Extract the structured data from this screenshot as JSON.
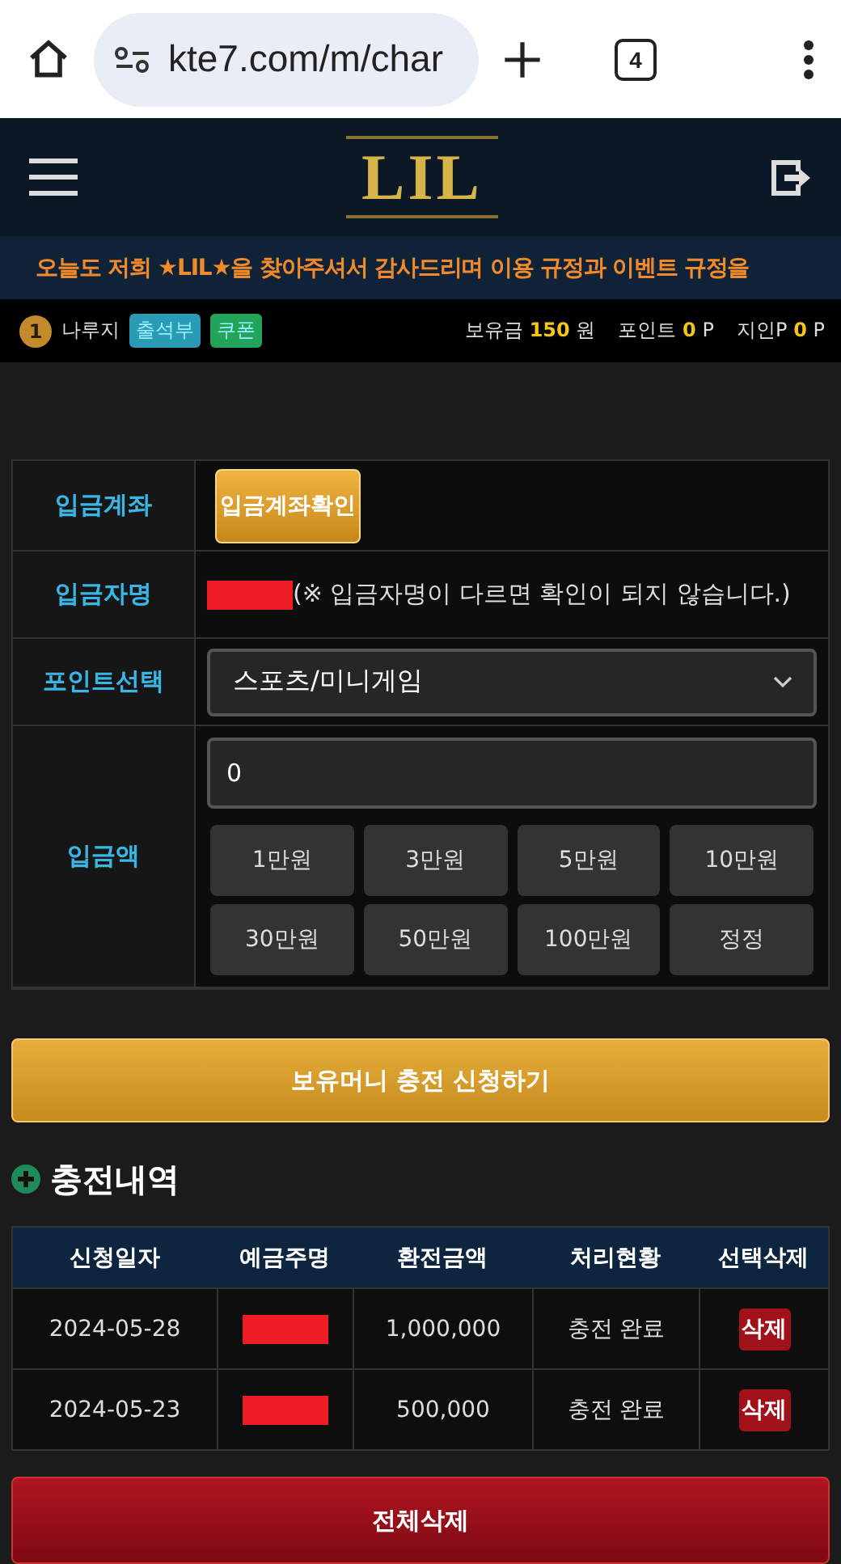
{
  "browser": {
    "url": "kte7.com/m/char",
    "tab_count": "4"
  },
  "header": {
    "logo": "LIL"
  },
  "marquee": "오늘도 저희 ★LIL★을 찾아주셔서 감사드리며 이용 규정과 이벤트 규정을",
  "user_bar": {
    "level": "1",
    "nickname": "나루지",
    "badges": [
      {
        "label": "출석부",
        "color": "#2a9bb5"
      },
      {
        "label": "쿠폰",
        "color": "#22a55a"
      }
    ],
    "stats": [
      {
        "label": "보유금",
        "value": "150",
        "unit": "원"
      },
      {
        "label": "포인트",
        "value": "0",
        "unit": "P"
      },
      {
        "label": "지인P",
        "value": "0",
        "unit": "P"
      }
    ]
  },
  "form": {
    "account_label": "입금계좌",
    "account_button": "입금계좌확인",
    "name_label": "입금자명",
    "name_note": "(※ 입금자명이 다르면 확인이 되지 않습니다.)",
    "point_label": "포인트선택",
    "point_value": "스포츠/미니게임",
    "amount_label": "입금액",
    "amount_value": "0",
    "amount_buttons": [
      "1만원",
      "3만원",
      "5만원",
      "10만원",
      "30만원",
      "50만원",
      "100만원",
      "정정"
    ]
  },
  "submit_button": "보유머니 충전 신청하기",
  "history": {
    "title": "충전내역",
    "columns": [
      "신청일자",
      "예금주명",
      "환전금액",
      "처리현황",
      "선택삭제"
    ],
    "rows": [
      {
        "date": "2024-05-28",
        "amount": "1,000,000",
        "status": "충전 완료",
        "action": "삭제"
      },
      {
        "date": "2024-05-23",
        "amount": "500,000",
        "status": "충전 완료",
        "action": "삭제"
      }
    ]
  },
  "delete_all_button": "전체삭제"
}
